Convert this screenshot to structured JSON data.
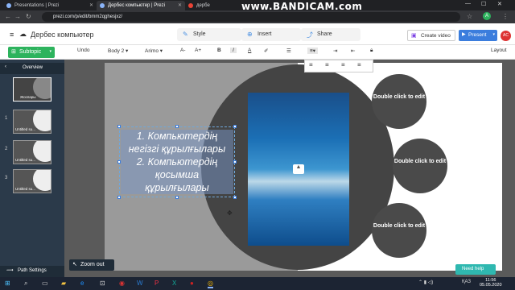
{
  "browser": {
    "tabs": [
      {
        "title": "Presentations | Prezi"
      },
      {
        "title": "Дербес компьютер | Prezi"
      },
      {
        "title": "дербе"
      }
    ],
    "url": "prezi.com/p/edit/bmm2qghesjxz/",
    "watermark": "www.BANDICAM.com"
  },
  "header": {
    "title": "Дербес компьютер",
    "style_label": "Style",
    "insert_label": "Insert",
    "share_label": "Share",
    "create_video_label": "Create video",
    "present_label": "Present",
    "avatar_initials": "AC"
  },
  "toolbar": {
    "undo_label": "Undo",
    "style_select": "Body 2",
    "font_select": "Arimo",
    "layout_label": "Layout"
  },
  "sidebar": {
    "subtopic_label": "Subtopic",
    "overview_label": "Overview",
    "overview_thumb_label": "Жоспары",
    "items": [
      {
        "num": "1",
        "label": "Untitled su..."
      },
      {
        "num": "2",
        "label": "Untitled su..."
      },
      {
        "num": "3",
        "label": "Untitled su..."
      }
    ],
    "path_settings_label": "Path Settings"
  },
  "canvas": {
    "text_lines": [
      "1. Компьютердің",
      "негізгі құрылғылары",
      "2. Компьютердің",
      "қосымша",
      "құрылғылары"
    ],
    "circle_label_1": "Double click to edit",
    "circle_label_2": "Double click to edit",
    "circle_label_3": "Double click to edit"
  },
  "bottom": {
    "zoom_out_label": "Zoom out",
    "need_help_label": "Need help"
  },
  "taskbar": {
    "language": "ҚАЗ",
    "time": "11:56",
    "date": "05.05.2020"
  }
}
